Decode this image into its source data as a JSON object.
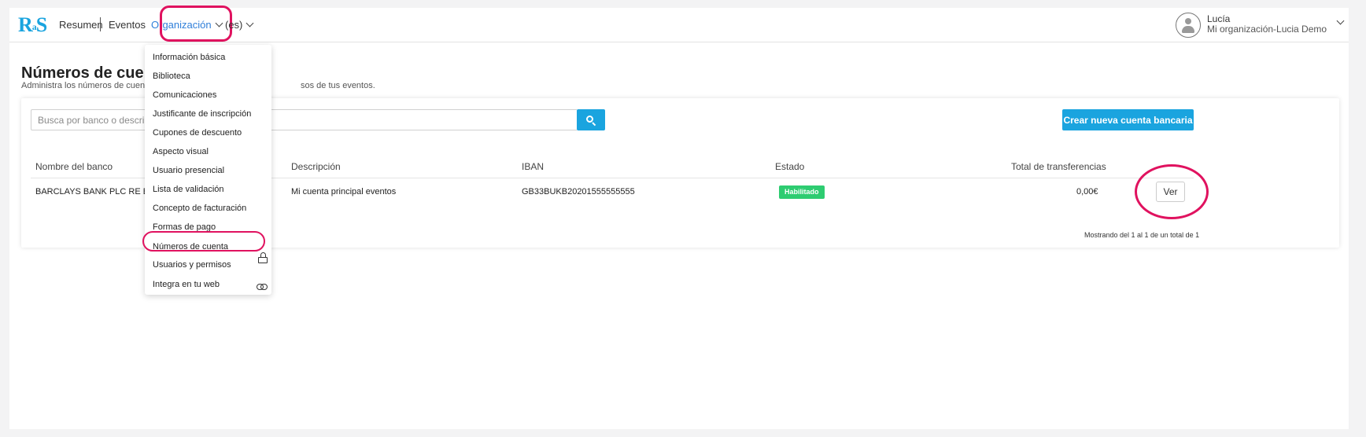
{
  "nav": {
    "logo": "RIS",
    "links": [
      "Resumen",
      "Eventos",
      "Organización",
      "(es)"
    ],
    "user_name": "Lucía",
    "user_org": "Mi organización-Lucia Demo"
  },
  "page": {
    "title": "Números de cuenta",
    "subtitle_start": "Administra los números de cuenta b",
    "subtitle_end": "sos de tus eventos."
  },
  "search": {
    "placeholder": "Busca por banco o descripc",
    "button_icon": "search-icon"
  },
  "create_button": "Crear nueva cuenta bancaria",
  "table": {
    "headers": [
      "Nombre del banco",
      "Descripción",
      "IBAN",
      "Estado",
      "Total de transferencias"
    ],
    "rows": [
      {
        "bank": "BARCLAYS BANK PLC RE BUK",
        "description": "Mi cuenta principal eventos",
        "iban": "GB33BUKB20201555555555",
        "status": "Habilitado",
        "total": "0,00€",
        "action": "Ver"
      }
    ],
    "footer": "Mostrando del 1 al 1 de un total de 1"
  },
  "dropdown": {
    "items": [
      "Información básica",
      "Biblioteca",
      "Comunicaciones",
      "Justificante de inscripción",
      "Cupones de descuento",
      "Aspecto visual",
      "Usuario presencial",
      "Lista de validación",
      "Concepto de facturación",
      "Formas de pago",
      "Números de cuenta",
      "Usuarios y permisos",
      "Integra en tu web"
    ],
    "icons": {
      "usuarios": "lock-icon",
      "integra": "link-icon"
    }
  },
  "colors": {
    "accent": "#1aa4df",
    "active_link": "#2f7fd9",
    "highlight": "#e0125f",
    "status_ok": "#2ecc71"
  }
}
